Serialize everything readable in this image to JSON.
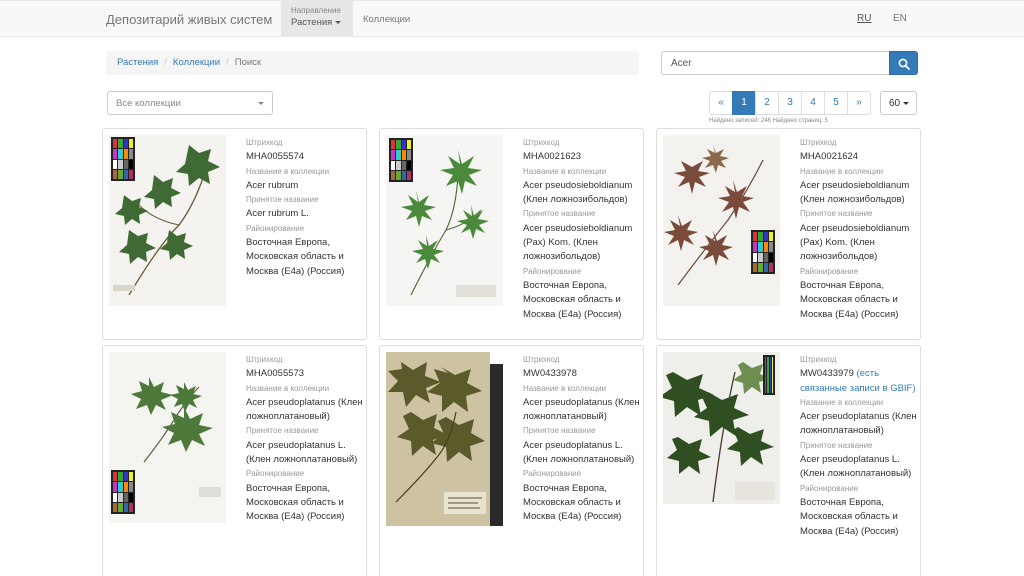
{
  "navbar": {
    "brand": "Депозитарий живых систем",
    "direction_small": "Направление",
    "direction_main": "Растения",
    "collections": "Коллекции",
    "lang_ru": "RU",
    "lang_en": "EN"
  },
  "breadcrumb": {
    "items": [
      "Растения",
      "Коллекции"
    ],
    "current": "Поиск"
  },
  "search": {
    "value": "Acer"
  },
  "filter": {
    "collection_selected": "Все коллекции"
  },
  "pagination": {
    "prev": "«",
    "pages": [
      "1",
      "2",
      "3",
      "4",
      "5"
    ],
    "active": "1",
    "next": "»",
    "per_page": "60",
    "count_note": "Найдено записей: 248 Найдено страниц: 5"
  },
  "labels": {
    "barcode": "Штрихкод",
    "collection_name": "Название в коллекции",
    "accepted_name": "Принятое название",
    "region": "Районирование"
  },
  "records": [
    {
      "barcode": "MHA0055574",
      "collection_name": "Acer rubrum",
      "accepted_name": "Acer rubrum L.",
      "region": "Восточная Европа, Московская область и Москва (E4a) (Россия)"
    },
    {
      "barcode": "MHA0021623",
      "collection_name": "Acer pseudosieboldianum (Клен ложнозибольдов)",
      "accepted_name": "Acer pseudosieboldianum (Pax) Kom. (Клен ложнозибольдов)",
      "region": "Восточная Европа, Московская область и Москва (E4a) (Россия)"
    },
    {
      "barcode": "MHA0021624",
      "collection_name": "Acer pseudosieboldianum (Клен ложнозибольдов)",
      "accepted_name": "Acer pseudosieboldianum (Pax) Kom. (Клен ложнозибольдов)",
      "region": "Восточная Европа, Московская область и Москва (E4a) (Россия)"
    },
    {
      "barcode": "MHA0055573",
      "collection_name": "Acer pseudoplatanus (Клен ложноплатановый)",
      "accepted_name": "Acer pseudoplatanus L. (Клен ложноплатановый)",
      "region": "Восточная Европа, Московская область и Москва (E4a) (Россия)"
    },
    {
      "barcode": "MW0433978",
      "collection_name": "Acer pseudoplatanus (Клен ложноплатановый)",
      "accepted_name": "Acer pseudoplatanus L. (Клен ложноплатановый)",
      "region": "Восточная Европа, Московская область и Москва (E4a) (Россия)"
    },
    {
      "barcode": "MW0433979",
      "gbif_link": "(есть связанные записи в GBIF)",
      "collection_name": "Acer pseudoplatanus (Клен ложноплатановый)",
      "accepted_name": "Acer pseudoplatanus L. (Клен ложноплатановый)",
      "region": "Восточная Европа, Московская область и Москва (E4a) (Россия)"
    }
  ],
  "colors": {
    "primary": "#337ab7",
    "navbar_bg": "#f8f8f8"
  }
}
